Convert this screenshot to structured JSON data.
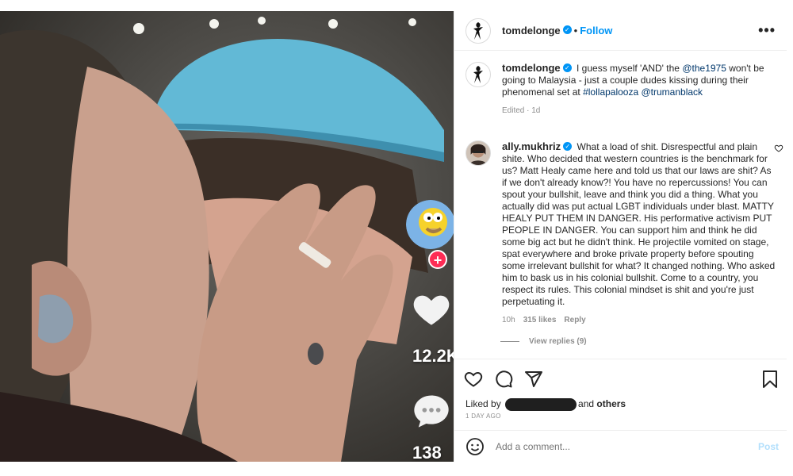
{
  "post": {
    "author": "tomdelonge",
    "follow_label": "Follow",
    "more_label": "•••",
    "caption_prefix": "I guess myself 'AND' the",
    "caption_mention": "@the1975",
    "caption_mid": "won't be going to Malaysia - just a couple dudes kissing during their phenomenal set at",
    "caption_hashtag": "#lollapalooza",
    "caption_mention2": "@trumanblack",
    "caption_meta": "Edited · 1d"
  },
  "comment": {
    "author": "ally.mukhriz",
    "text": "What a load of shit. Disrespectful and plain shite. Who decided that western countries is the benchmark for us? Matt Healy came here and told us that our laws are shit? As if we don't already know?! You have no repercussions! You can spout your bullshit, leave and think you did a thing. What you actually did was put actual LGBT individuals under blast. MATTY HEALY PUT THEM IN DANGER. His performative activism PUT PEOPLE IN DANGER. You can support him and think he did some big act but he didn't think. He projectile vomited on stage, spat everywhere and broke private property before spouting some irrelevant bullshit for what? It changed nothing. Who asked him to bask us in his colonial bullshit. Come to a country, you respect its rules. This colonial mindset is shit and you're just perpetuating it.",
    "time": "10h",
    "likes": "315 likes",
    "reply_label": "Reply",
    "view_replies": "View replies (9)"
  },
  "footer": {
    "liked_prefix": "Liked by",
    "liked_suffix": "and",
    "others": "others",
    "date": "1 DAY AGO",
    "add_comment_placeholder": "Add a comment...",
    "post_label": "Post"
  },
  "media": {
    "like_count": "12.2K",
    "comment_count": "138"
  },
  "colors": {
    "accent": "#0095f6",
    "link": "#00376b",
    "post_disabled": "#b2dffc",
    "tiktok_red": "#fe2c55"
  },
  "icons": [
    "heart-icon",
    "comment-icon",
    "share-icon",
    "bookmark-icon",
    "emoji-icon",
    "more-icon",
    "verified-icon"
  ]
}
